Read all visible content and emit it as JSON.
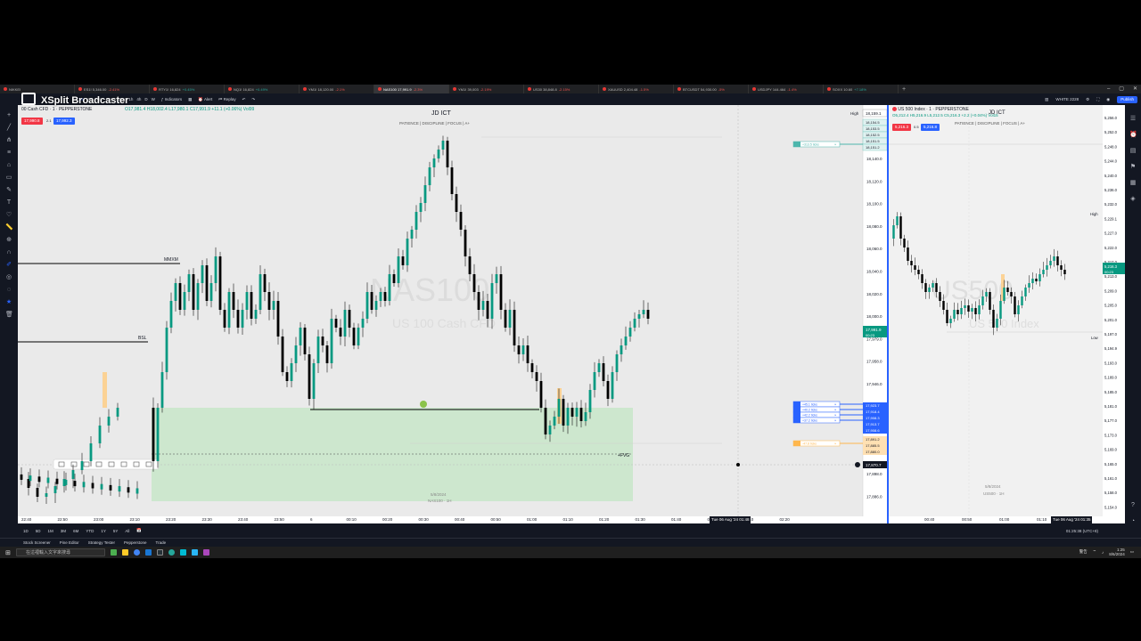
{
  "browser_tabs": [
    {
      "symbol": "NIKKEI",
      "price": "",
      "change": "",
      "active": false
    },
    {
      "symbol": "ES1!",
      "price": "5,346.00",
      "change": "-2.41%",
      "active": false
    },
    {
      "symbol": "RTY1!",
      "price": "16,824",
      "change": "+0.45%",
      "active": false
    },
    {
      "symbol": "NQ1!",
      "price": "16,824",
      "change": "+0.49%",
      "active": false
    },
    {
      "symbol": "YM1!",
      "price": "18,120.00",
      "change": "-2.1%",
      "active": false
    },
    {
      "symbol": "NAS100",
      "price": "17,991.9",
      "change": "-2.3%",
      "active": true
    },
    {
      "symbol": "YM1!",
      "price": "39,003",
      "change": "-2.19%",
      "active": false
    },
    {
      "symbol": "US30",
      "price": "38,848.8",
      "change": "-2.15%",
      "active": false
    },
    {
      "symbol": "XAUUSD",
      "price": "2,404.48",
      "change": "-1.5%",
      "active": false
    },
    {
      "symbol": "BTCUSDT",
      "price": "54,930.00",
      "change": "-5%",
      "active": false
    },
    {
      "symbol": "USDJPY",
      "price": "144.464",
      "change": "-1.4%",
      "active": false
    },
    {
      "symbol": "SOXX",
      "price": "10.60",
      "change": "+7.18%",
      "active": false
    }
  ],
  "overlay": {
    "brand": "XSplit Broadcaster"
  },
  "toolbar": {
    "intervals": [
      "1m",
      "3m",
      "5m",
      "15m",
      "30m",
      "1h",
      "4h",
      "D",
      "W"
    ],
    "indicators_label": "Indicators",
    "alert_label": "Alert",
    "replay_label": "Replay",
    "layout_name": "WHITE 2228",
    "publish_label": "Publish"
  },
  "left_chart": {
    "legend": "00 Cash CFD · 1 · PEPPERSTONE",
    "ohlc": "O17,981.4 H18,002.4 L17,980.1 C17,991.9 +11.1 (+0.06%) Vol99",
    "sell_price": "17,990.8",
    "buy_price": "17,992.3",
    "spread": "2.1",
    "header_title": "JD ICT",
    "header_motto": "PATIENCE | DISCIPLINE | FOCUS | A+",
    "watermark_symbol": "NAS100",
    "watermark_name": "US 100 Cash CFD",
    "labels": {
      "mmxm": "MMXM",
      "bsl": "BSL",
      "fvg": "+FVG",
      "date_note": "5/8/2024",
      "symbol_note": "NAS100 · 1H"
    },
    "price_scale": [
      "18,140.0",
      "18,120.0",
      "18,100.0",
      "18,080.0",
      "18,060.0",
      "18,040.0",
      "18,020.0",
      "18,000.0",
      "17,979.0",
      "17,958.0",
      "17,946.0",
      "17,934.0",
      "17,922.0",
      "17,910.0",
      "17,898.0",
      "17,886.0",
      "17,874.0",
      "17,861.0",
      "17,849.0"
    ],
    "high_label": "High",
    "high_price": "18,159.1",
    "stack_prices": [
      "18,154.5",
      "18,153.5",
      "18,152.5",
      "18,151.5",
      "18,151.2"
    ],
    "current_price": "17,991.9",
    "countdown": "00:23",
    "order_prices": [
      "17,923.7",
      "17,918.4",
      "17,908.3",
      "17,913.7",
      "17,908.6"
    ],
    "sl_prices": [
      "17,891.2",
      "17,885.5",
      "17,880.0"
    ],
    "crosshair_price": "17,870.7",
    "time_scale": [
      "22:40",
      "22:50",
      "23:00",
      "23:10",
      "23:20",
      "23:30",
      "23:40",
      "23:50",
      "6",
      "00:10",
      "00:20",
      "00:30",
      "00:40",
      "00:50",
      "01:00",
      "01:10",
      "01:20",
      "01:30",
      "01:40",
      "02:00",
      "02:10",
      "02:20"
    ],
    "crosshair_time": "Tue 06 Aug '24  01:48",
    "order_ticks": [
      "+313.5 ticks",
      "+45.1 ticks",
      "+40.2 ticks",
      "+42.2 ticks",
      "+37.2 ticks",
      "-47.8 ticks"
    ]
  },
  "right_chart": {
    "legend": "US 500 Index · 1 · PEPPERSTONE",
    "ohlc": "O5,212.4 H5,216.9 L5,212.5 C5,216.3 +2.2 (+0.04%) Vol15",
    "sell_price": "5,216.3",
    "buy_price": "5,216.8",
    "spread": "0.5",
    "header_title": "JD ICT",
    "header_motto": "PATIENCE | DISCIPLINE | FOCUS | A+",
    "watermark_symbol": "US500",
    "watermark_name": "US 500 Index",
    "price_scale": [
      "5,256.0",
      "5,252.0",
      "5,248.0",
      "5,244.0",
      "5,240.0",
      "5,236.0",
      "5,232.0",
      "5,229.1",
      "5,227.0",
      "5,222.0",
      "5,217.0",
      "5,213.0",
      "5,209.0",
      "5,205.0",
      "5,201.0",
      "5,197.0",
      "5,194.9",
      "5,193.0",
      "5,189.0",
      "5,185.0",
      "5,181.0",
      "5,177.0",
      "5,173.0",
      "5,169.0",
      "5,165.0",
      "5,161.0",
      "5,158.0",
      "5,154.0"
    ],
    "high_label": "High",
    "low_label": "Low",
    "current_price": "5,216.3",
    "countdown": "00:23",
    "date_note": "5/8/2024",
    "symbol_note": "US500 · 1H",
    "time_scale": [
      "00:40",
      "00:50",
      "01:00",
      "01:10",
      "01:20"
    ],
    "crosshair_time": "Tue 06 Aug '24  01:35"
  },
  "range_bar": {
    "ranges": [
      "1D",
      "5D",
      "1M",
      "3M",
      "6M",
      "YTD",
      "1Y",
      "5Y",
      "All"
    ],
    "clock": "01:25:38 (UTC+8)"
  },
  "bottom_tabs": [
    "Stock Screener",
    "Pine Editor",
    "Strategy Tester",
    "Pepperstone",
    "Trade"
  ],
  "taskbar": {
    "search_placeholder": "在這裡輸入文字來搜尋",
    "time": "1:25",
    "date": "8/6/2024",
    "weather": "警告"
  },
  "colors": {
    "bull": "#089981",
    "bear": "#000000",
    "fvg_zone": "#c8e6c9",
    "accent": "#2962ff",
    "sell": "#f23645"
  }
}
